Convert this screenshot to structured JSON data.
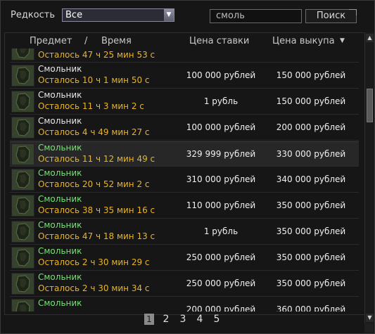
{
  "filter": {
    "rarity_label": "Редкость",
    "rarity_value": "Все",
    "search_placeholder": "смоль",
    "search_button": "Поиск"
  },
  "header": {
    "item": "Предмет",
    "separator": "/",
    "time": "Время",
    "bid": "Цена ставки",
    "buyout": "Цена выкупа"
  },
  "colors": {
    "time_text": "#e8b42a",
    "green_name": "#6ee86e"
  },
  "rows": [
    {
      "name": "",
      "name_color": "white",
      "time": "Осталось 47 ч 25 мин 53 с",
      "bid": "",
      "buyout": ""
    },
    {
      "name": "Смольник",
      "name_color": "white",
      "time": "Осталось 10 ч 1 мин 50 с",
      "bid": "100 000 рублей",
      "buyout": "150 000 рублей"
    },
    {
      "name": "Смольник",
      "name_color": "white",
      "time": "Осталось 11 ч 3 мин 2 с",
      "bid": "1 рубль",
      "buyout": "150 000 рублей"
    },
    {
      "name": "Смольник",
      "name_color": "white",
      "time": "Осталось 4 ч 49 мин 27 с",
      "bid": "100 000 рублей",
      "buyout": "200 000 рублей"
    },
    {
      "name": "Смольник",
      "name_color": "green",
      "time": "Осталось 11 ч 12 мин 49 с",
      "bid": "329 999 рублей",
      "buyout": "330 000 рублей"
    },
    {
      "name": "Смольник",
      "name_color": "green",
      "time": "Осталось 20 ч 52 мин 2 с",
      "bid": "310 000 рублей",
      "buyout": "340 000 рублей"
    },
    {
      "name": "Смольник",
      "name_color": "green",
      "time": "Осталось 38 ч 35 мин 16 с",
      "bid": "110 000 рублей",
      "buyout": "350 000 рублей"
    },
    {
      "name": "Смольник",
      "name_color": "green",
      "time": "Осталось 47 ч 18 мин 13 с",
      "bid": "1 рубль",
      "buyout": "350 000 рублей"
    },
    {
      "name": "Смольник",
      "name_color": "green",
      "time": "Осталось 2 ч 30 мин 29 с",
      "bid": "250 000 рублей",
      "buyout": "350 000 рублей"
    },
    {
      "name": "Смольник",
      "name_color": "green",
      "time": "Осталось 2 ч 30 мин 34 с",
      "bid": "250 000 рублей",
      "buyout": "350 000 рублей"
    },
    {
      "name": "Смольник",
      "name_color": "green",
      "time": "",
      "bid": "200 000 рублей",
      "buyout": "360 000 рублей"
    }
  ],
  "pagination": {
    "pages": [
      "1",
      "2",
      "3",
      "4",
      "5"
    ],
    "current": "1"
  }
}
